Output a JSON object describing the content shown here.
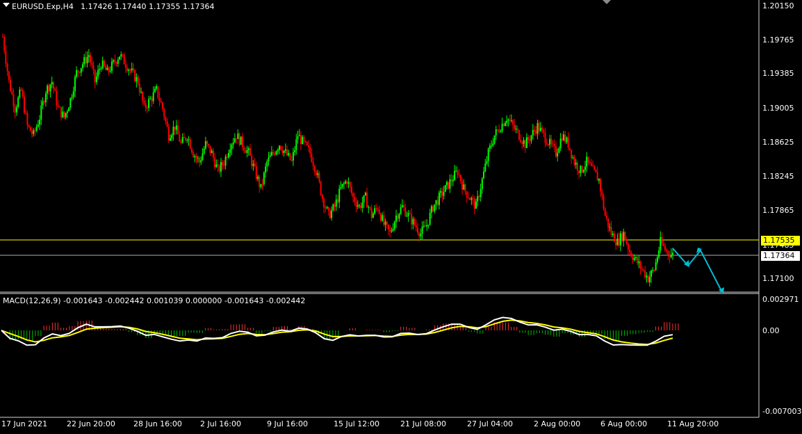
{
  "header": {
    "symbol": "EURUSD.Exp,H4",
    "ohlc": "1.17426 1.17440 1.17355 1.17364"
  },
  "price_axis": [
    "1.20150",
    "1.19765",
    "1.19385",
    "1.19005",
    "1.18625",
    "1.18245",
    "1.17865",
    "1.17485",
    "1.17100"
  ],
  "price_badges": {
    "level": "1.17535",
    "current": "1.17364"
  },
  "macd": {
    "label": "MACD(12,26,9) -0.001643 -0.002442 0.001039 0.000000 -0.001643 -0.002442",
    "axis": [
      "0.002971",
      "0.00",
      "-0.007003"
    ]
  },
  "time_axis": [
    "17 Jun 2021",
    "22 Jun 20:00",
    "28 Jun 16:00",
    "2 Jul 16:00",
    "9 Jul 16:00",
    "15 Jul 12:00",
    "21 Jul 08:00",
    "27 Jul 04:00",
    "2 Aug 00:00",
    "6 Aug 00:00",
    "11 Aug 20:00"
  ],
  "colors": {
    "bull": "#00ff00",
    "bear": "#ff0000",
    "level_line": "#ffff00",
    "macd_main": "#ffffff",
    "macd_signal": "#ffff00",
    "arrow": "#00bcd4",
    "hist_pos": "#ff3030",
    "hist_neg": "#00c000"
  },
  "chart_data": {
    "type": "candlestick",
    "symbol": "EURUSD.Exp",
    "timeframe": "H4",
    "closes": [
      1.198,
      1.193,
      1.19,
      1.192,
      1.188,
      1.187,
      1.189,
      1.192,
      1.193,
      1.19,
      1.189,
      1.191,
      1.194,
      1.195,
      1.196,
      1.193,
      1.195,
      1.194,
      1.195,
      1.196,
      1.195,
      1.194,
      1.193,
      1.19,
      1.191,
      1.192,
      1.19,
      1.187,
      1.188,
      1.186,
      1.187,
      1.185,
      1.184,
      1.186,
      1.185,
      1.183,
      1.184,
      1.186,
      1.187,
      1.186,
      1.185,
      1.183,
      1.181,
      1.184,
      1.185,
      1.186,
      1.185,
      1.184,
      1.187,
      1.186,
      1.185,
      1.183,
      1.18,
      1.178,
      1.179,
      1.181,
      1.182,
      1.18,
      1.179,
      1.18,
      1.178,
      1.179,
      1.177,
      1.176,
      1.178,
      1.179,
      1.178,
      1.177,
      1.176,
      1.177,
      1.179,
      1.18,
      1.181,
      1.182,
      1.183,
      1.181,
      1.18,
      1.179,
      1.182,
      1.185,
      1.187,
      1.188,
      1.189,
      1.188,
      1.187,
      1.186,
      1.187,
      1.188,
      1.187,
      1.186,
      1.185,
      1.187,
      1.186,
      1.184,
      1.183,
      1.184,
      1.183,
      1.182,
      1.178,
      1.176,
      1.175,
      1.176,
      1.174,
      1.173,
      1.172,
      1.171,
      1.172,
      1.175,
      1.174,
      1.1736
    ],
    "levels": [
      1.17535,
      1.17364
    ],
    "macd_params": [
      12,
      26,
      9
    ],
    "macd_values": [
      -0.001643,
      -0.002442,
      0.001039,
      0.0,
      -0.001643,
      -0.002442
    ]
  }
}
